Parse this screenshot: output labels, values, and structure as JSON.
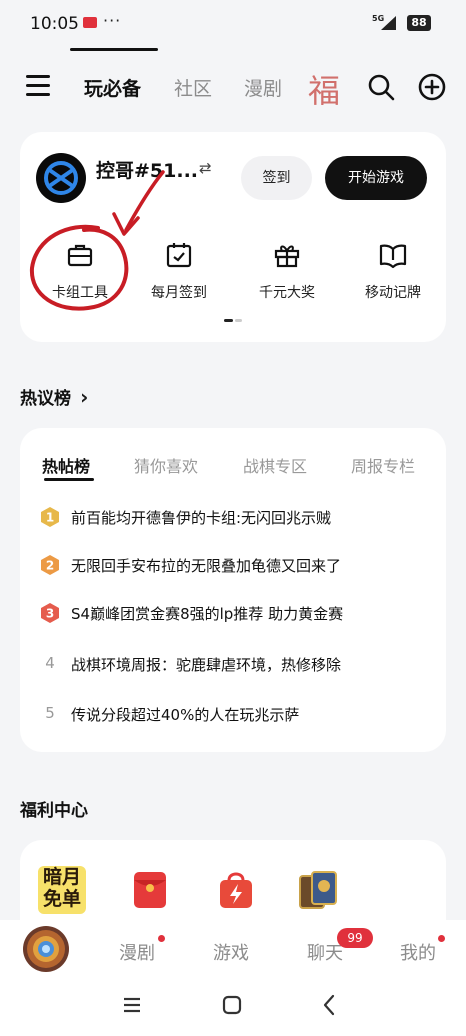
{
  "status_bar": {
    "time": "10:05",
    "dots": "···",
    "network": "5G",
    "battery": "88"
  },
  "top_nav": {
    "tabs": [
      "玩必备",
      "社区",
      "漫剧"
    ],
    "active_tab": "玩必备",
    "overflow_char": "福"
  },
  "profile": {
    "username": "控哥#51...",
    "swap_symbol": "⇄",
    "signin_label": "签到",
    "start_label": "开始游戏"
  },
  "quick_actions": [
    {
      "label": "卡组工具",
      "icon": "briefcase-icon"
    },
    {
      "label": "每月签到",
      "icon": "calendar-check-icon"
    },
    {
      "label": "千元大奖",
      "icon": "gift-icon"
    },
    {
      "label": "移动记牌",
      "icon": "book-icon"
    }
  ],
  "hot_section": {
    "title": "热议榜",
    "chevron": "›",
    "tabs": [
      "热帖榜",
      "猜你喜欢",
      "战棋专区",
      "周报专栏"
    ],
    "active_tab": "热帖榜",
    "items": [
      {
        "rank": "1",
        "text": "前百能均开德鲁伊的卡组:无闪回兆示贼"
      },
      {
        "rank": "2",
        "text": "无限回手安布拉的无限叠加龟德又回来了"
      },
      {
        "rank": "3",
        "text": "S4巅峰团赏金赛8强的lp推荐 助力黄金赛"
      },
      {
        "rank": "4",
        "text": "战棋环境周报：驼鹿肆虐环境，热修移除"
      },
      {
        "rank": "5",
        "text": "传说分段超过40%的人在玩兆示萨"
      }
    ],
    "rank_colors": {
      "gold": "#e7b84a",
      "orange": "#ec9a45",
      "red": "#e55c4d"
    }
  },
  "welfare": {
    "title": "福利中心",
    "items": [
      {
        "name": "暗月免单",
        "line1": "暗月",
        "line2": "免单"
      },
      {
        "name": "red-envelope-icon"
      },
      {
        "name": "shopping-bag-icon"
      },
      {
        "name": "card-pack-icon"
      }
    ]
  },
  "bottom_nav": {
    "items": [
      "漫剧",
      "游戏",
      "聊天",
      "我的"
    ],
    "chat_badge": "99"
  },
  "colors": {
    "accent_red": "#e0313c",
    "annotation": "#c81d25"
  }
}
